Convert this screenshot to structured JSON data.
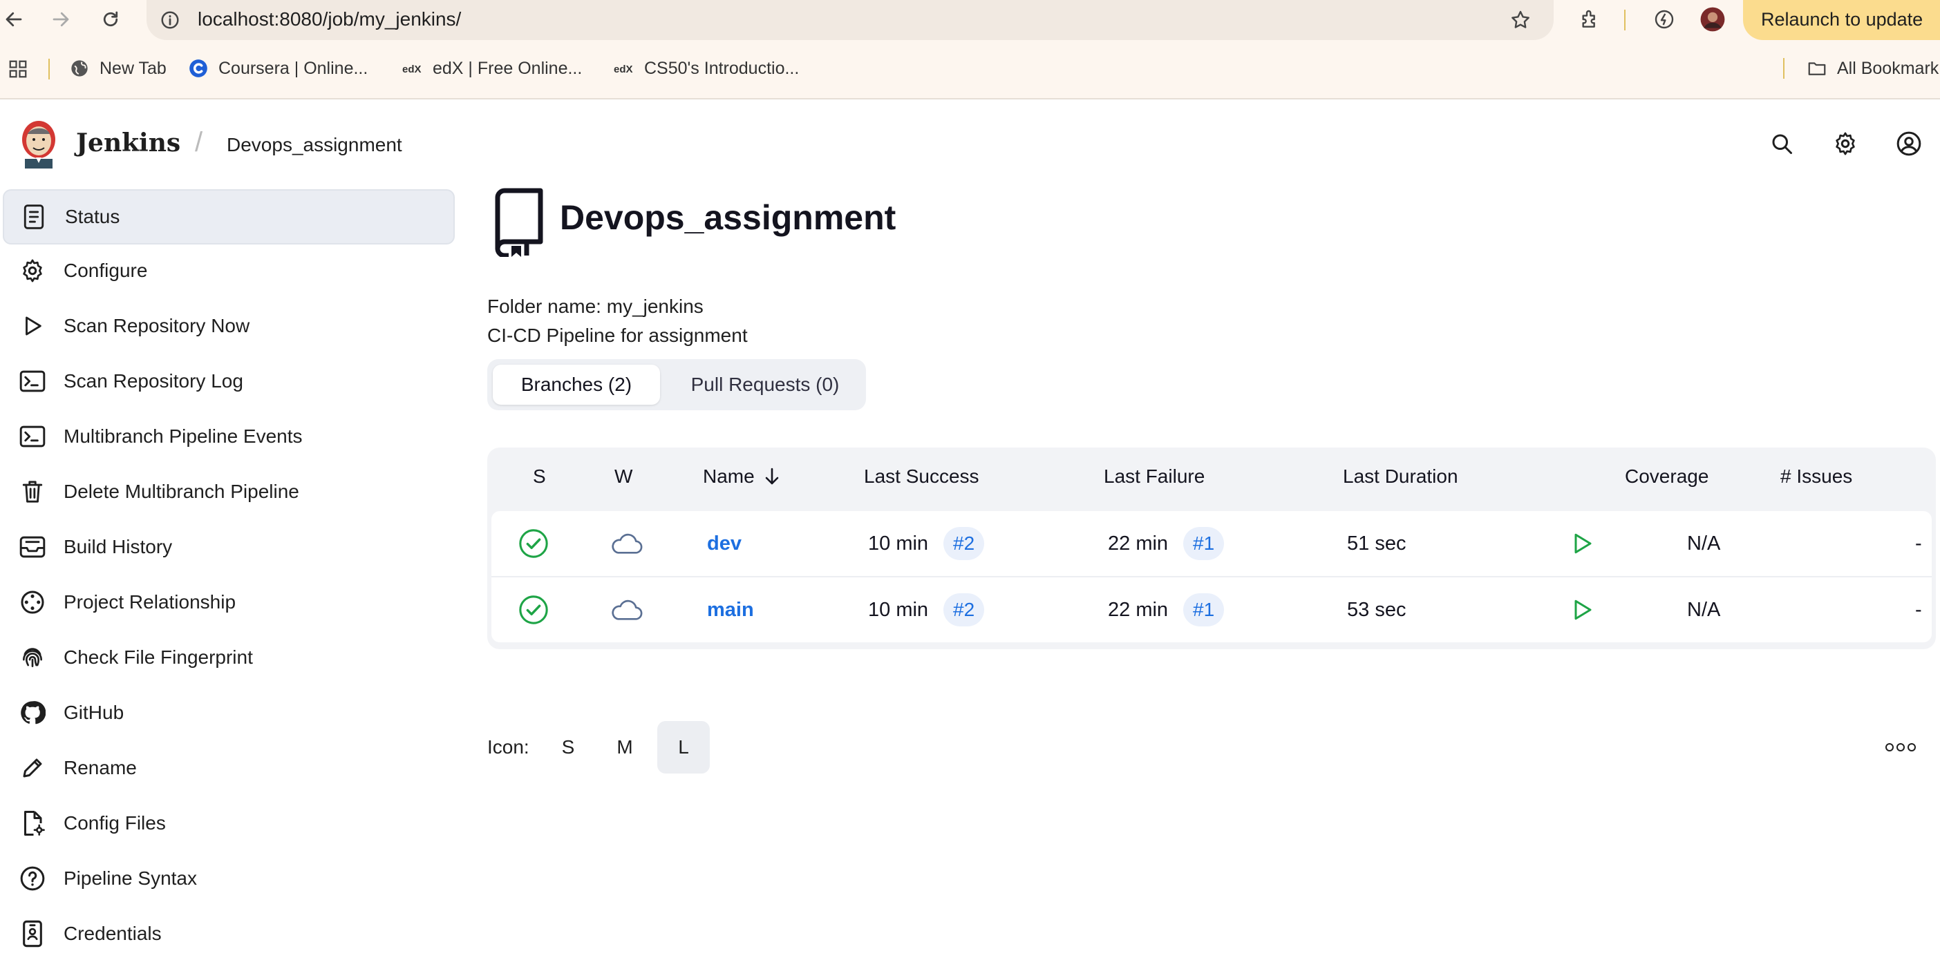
{
  "browser": {
    "url": "localhost:8080/job/my_jenkins/",
    "relaunch_label": "Relaunch to update",
    "bookmarks": [
      {
        "label": "New Tab"
      },
      {
        "label": "Coursera | Online..."
      },
      {
        "label": "edX | Free Online..."
      },
      {
        "label": "CS50's Introductio..."
      }
    ],
    "all_bookmarks_label": "All Bookmark"
  },
  "header": {
    "brand": "Jenkins",
    "separator": "/",
    "breadcrumb": "Devops_assignment"
  },
  "sidebar": {
    "items": [
      {
        "label": "Status",
        "icon": "document-icon"
      },
      {
        "label": "Configure",
        "icon": "gear-icon"
      },
      {
        "label": "Scan Repository Now",
        "icon": "play-icon"
      },
      {
        "label": "Scan Repository Log",
        "icon": "terminal-icon"
      },
      {
        "label": "Multibranch Pipeline Events",
        "icon": "terminal-icon"
      },
      {
        "label": "Delete Multibranch Pipeline",
        "icon": "trash-icon"
      },
      {
        "label": "Build History",
        "icon": "inbox-icon"
      },
      {
        "label": "Project Relationship",
        "icon": "relationship-icon"
      },
      {
        "label": "Check File Fingerprint",
        "icon": "fingerprint-icon"
      },
      {
        "label": "GitHub",
        "icon": "github-icon"
      },
      {
        "label": "Rename",
        "icon": "pencil-icon"
      },
      {
        "label": "Config Files",
        "icon": "config-file-icon"
      },
      {
        "label": "Pipeline Syntax",
        "icon": "help-icon"
      },
      {
        "label": "Credentials",
        "icon": "credentials-icon"
      }
    ]
  },
  "main": {
    "title": "Devops_assignment",
    "folder_name": "Folder name: my_jenkins",
    "description": "CI-CD Pipeline for assignment",
    "tabs": [
      {
        "label": "Branches (2)"
      },
      {
        "label": "Pull Requests (0)"
      }
    ],
    "table": {
      "headers": {
        "s": "S",
        "w": "W",
        "name": "Name",
        "last_success": "Last Success",
        "last_failure": "Last Failure",
        "last_duration": "Last Duration",
        "coverage": "Coverage",
        "issues": "# Issues"
      },
      "rows": [
        {
          "name": "dev",
          "last_success": "10 min",
          "success_build": "#2",
          "last_failure": "22 min",
          "failure_build": "#1",
          "last_duration": "51 sec",
          "coverage": "N/A",
          "issues": "-"
        },
        {
          "name": "main",
          "last_success": "10 min",
          "success_build": "#2",
          "last_failure": "22 min",
          "failure_build": "#1",
          "last_duration": "53 sec",
          "coverage": "N/A",
          "issues": "-"
        }
      ]
    },
    "icon_size": {
      "label": "Icon:",
      "options": [
        "S",
        "M",
        "L"
      ],
      "selected": "L"
    }
  },
  "colors": {
    "success": "#1ea446",
    "link": "#1d6fe0",
    "relaunch": "#fbdc8e"
  }
}
